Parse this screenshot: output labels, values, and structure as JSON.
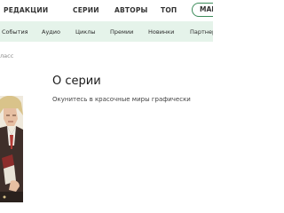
{
  "top_nav": {
    "items": [
      "РЕДАКЦИИ",
      "СЕРИИ",
      "АВТОРЫ",
      "ТОП"
    ],
    "shop_button": "МАГ"
  },
  "sub_nav": {
    "items": [
      "События",
      "Аудио",
      "Циклы",
      "Премии",
      "Новинки",
      "Партнер"
    ]
  },
  "breadcrumb": "ласс",
  "section": {
    "title": "О серии",
    "description": "Окунитесь в красочные миры графически"
  },
  "colors": {
    "accent": "#3d8c5b",
    "subnav_bg": "#e5f3ea"
  }
}
